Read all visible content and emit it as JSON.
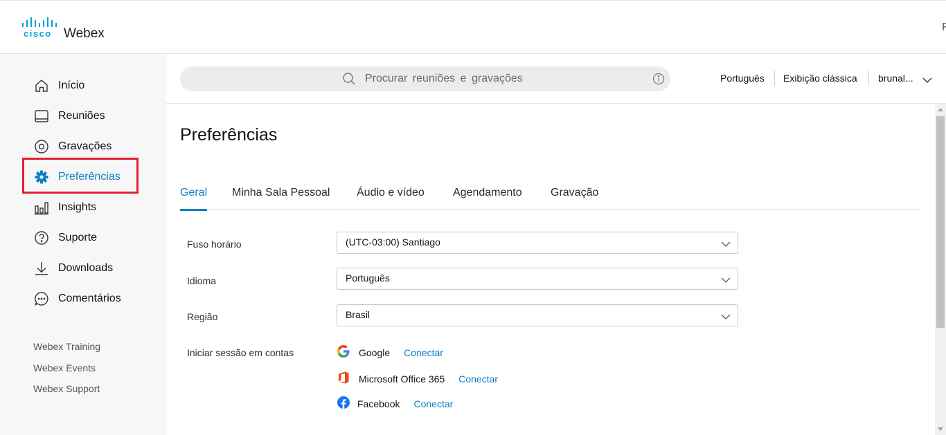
{
  "brand": {
    "cisco": "cisco",
    "product": "Webex",
    "accent": "#049fd9"
  },
  "topbar": {
    "edge_letter": "F"
  },
  "sidebar": {
    "items": [
      {
        "label": "Início",
        "icon": "home-icon"
      },
      {
        "label": "Reuniões",
        "icon": "meetings-icon"
      },
      {
        "label": "Gravações",
        "icon": "recordings-icon"
      },
      {
        "label": "Preferências",
        "icon": "gear-icon",
        "active": true
      },
      {
        "label": "Insights",
        "icon": "insights-icon"
      },
      {
        "label": "Suporte",
        "icon": "help-icon"
      },
      {
        "label": "Downloads",
        "icon": "download-icon"
      },
      {
        "label": "Comentários",
        "icon": "comment-icon"
      }
    ],
    "footer_links": [
      "Webex Training",
      "Webex Events",
      "Webex Support"
    ]
  },
  "header": {
    "search_placeholder": "Procurar reuniões e gravações",
    "language": "Português",
    "classic_view": "Exibição clássica",
    "user": "brunal..."
  },
  "page": {
    "title": "Preferências",
    "tabs": [
      "Geral",
      "Minha Sala Pessoal",
      "Áudio e vídeo",
      "Agendamento",
      "Gravação"
    ],
    "active_tab": "Geral",
    "fields": {
      "timezone": {
        "label": "Fuso horário",
        "value": "(UTC-03:00) Santiago"
      },
      "language": {
        "label": "Idioma",
        "value": "Português"
      },
      "region": {
        "label": "Região",
        "value": "Brasil"
      }
    },
    "accounts": {
      "label": "Iniciar sessão em contas",
      "items": [
        {
          "name": "Google",
          "action": "Conectar"
        },
        {
          "name": "Microsoft Office 365",
          "action": "Conectar"
        },
        {
          "name": "Facebook",
          "action": "Conectar"
        }
      ]
    }
  },
  "colors": {
    "link": "#0a7fc2",
    "highlight_box": "#e5202e",
    "sidebar_bg": "#f7f7f7"
  }
}
